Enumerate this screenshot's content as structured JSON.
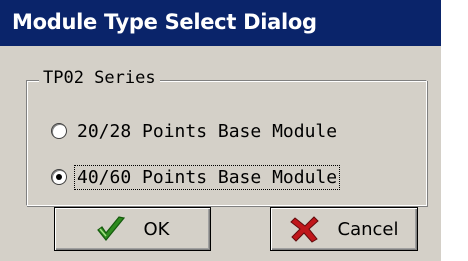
{
  "window": {
    "title": "Module Type Select Dialog"
  },
  "group": {
    "label": "TP02 Series",
    "options": [
      {
        "label": "20/28 Points Base Module",
        "selected": false
      },
      {
        "label": "40/60 Points Base Module",
        "selected": true,
        "focused": true
      }
    ]
  },
  "buttons": {
    "ok_label": "OK",
    "ok_icon": "checkmark-icon",
    "cancel_label": "Cancel",
    "cancel_icon": "x-icon"
  },
  "colors": {
    "titlebar": "#0a246a",
    "face": "#d4d0c8",
    "check": "#2e8b1f",
    "cross": "#c0161b"
  }
}
